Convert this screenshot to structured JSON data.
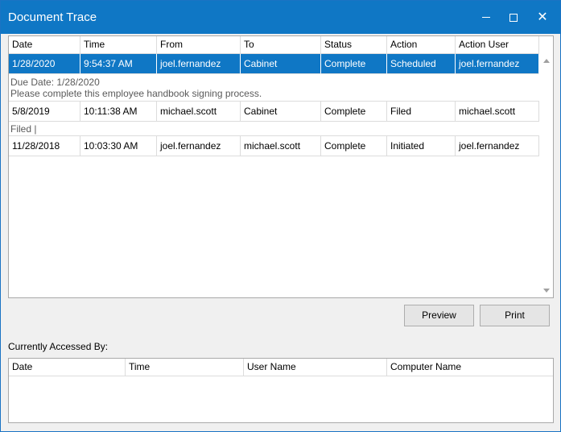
{
  "window": {
    "title": "Document Trace",
    "title_bar_color": "#0f77c5",
    "controls": {
      "minimize": "minimize-icon",
      "maximize": "maximize-icon",
      "close": "close-icon",
      "close_glyph": "✕"
    }
  },
  "trace": {
    "headers": [
      "Date",
      "Time",
      "From",
      "To",
      "Status",
      "Action",
      "Action User"
    ],
    "rows": [
      {
        "cells": [
          "1/28/2020",
          "9:54:37 AM",
          "joel.fernandez",
          "Cabinet",
          "Complete",
          "Scheduled",
          "joel.fernandez"
        ],
        "selected": true,
        "detail": [
          "Due Date: 1/28/2020",
          "Please complete this employee handbook signing process."
        ]
      },
      {
        "cells": [
          "5/8/2019",
          "10:11:38 AM",
          "michael.scott",
          "Cabinet",
          "Complete",
          "Filed",
          "michael.scott"
        ],
        "selected": false,
        "detail": [
          "Filed |"
        ]
      },
      {
        "cells": [
          "11/28/2018",
          "10:03:30 AM",
          "joel.fernandez",
          "michael.scott",
          "Complete",
          "Initiated",
          "joel.fernandez"
        ],
        "selected": false
      }
    ]
  },
  "buttons": {
    "preview": "Preview",
    "print": "Print"
  },
  "access": {
    "label": "Currently Accessed By:",
    "headers": [
      "Date",
      "Time",
      "User Name",
      "Computer Name"
    ]
  }
}
